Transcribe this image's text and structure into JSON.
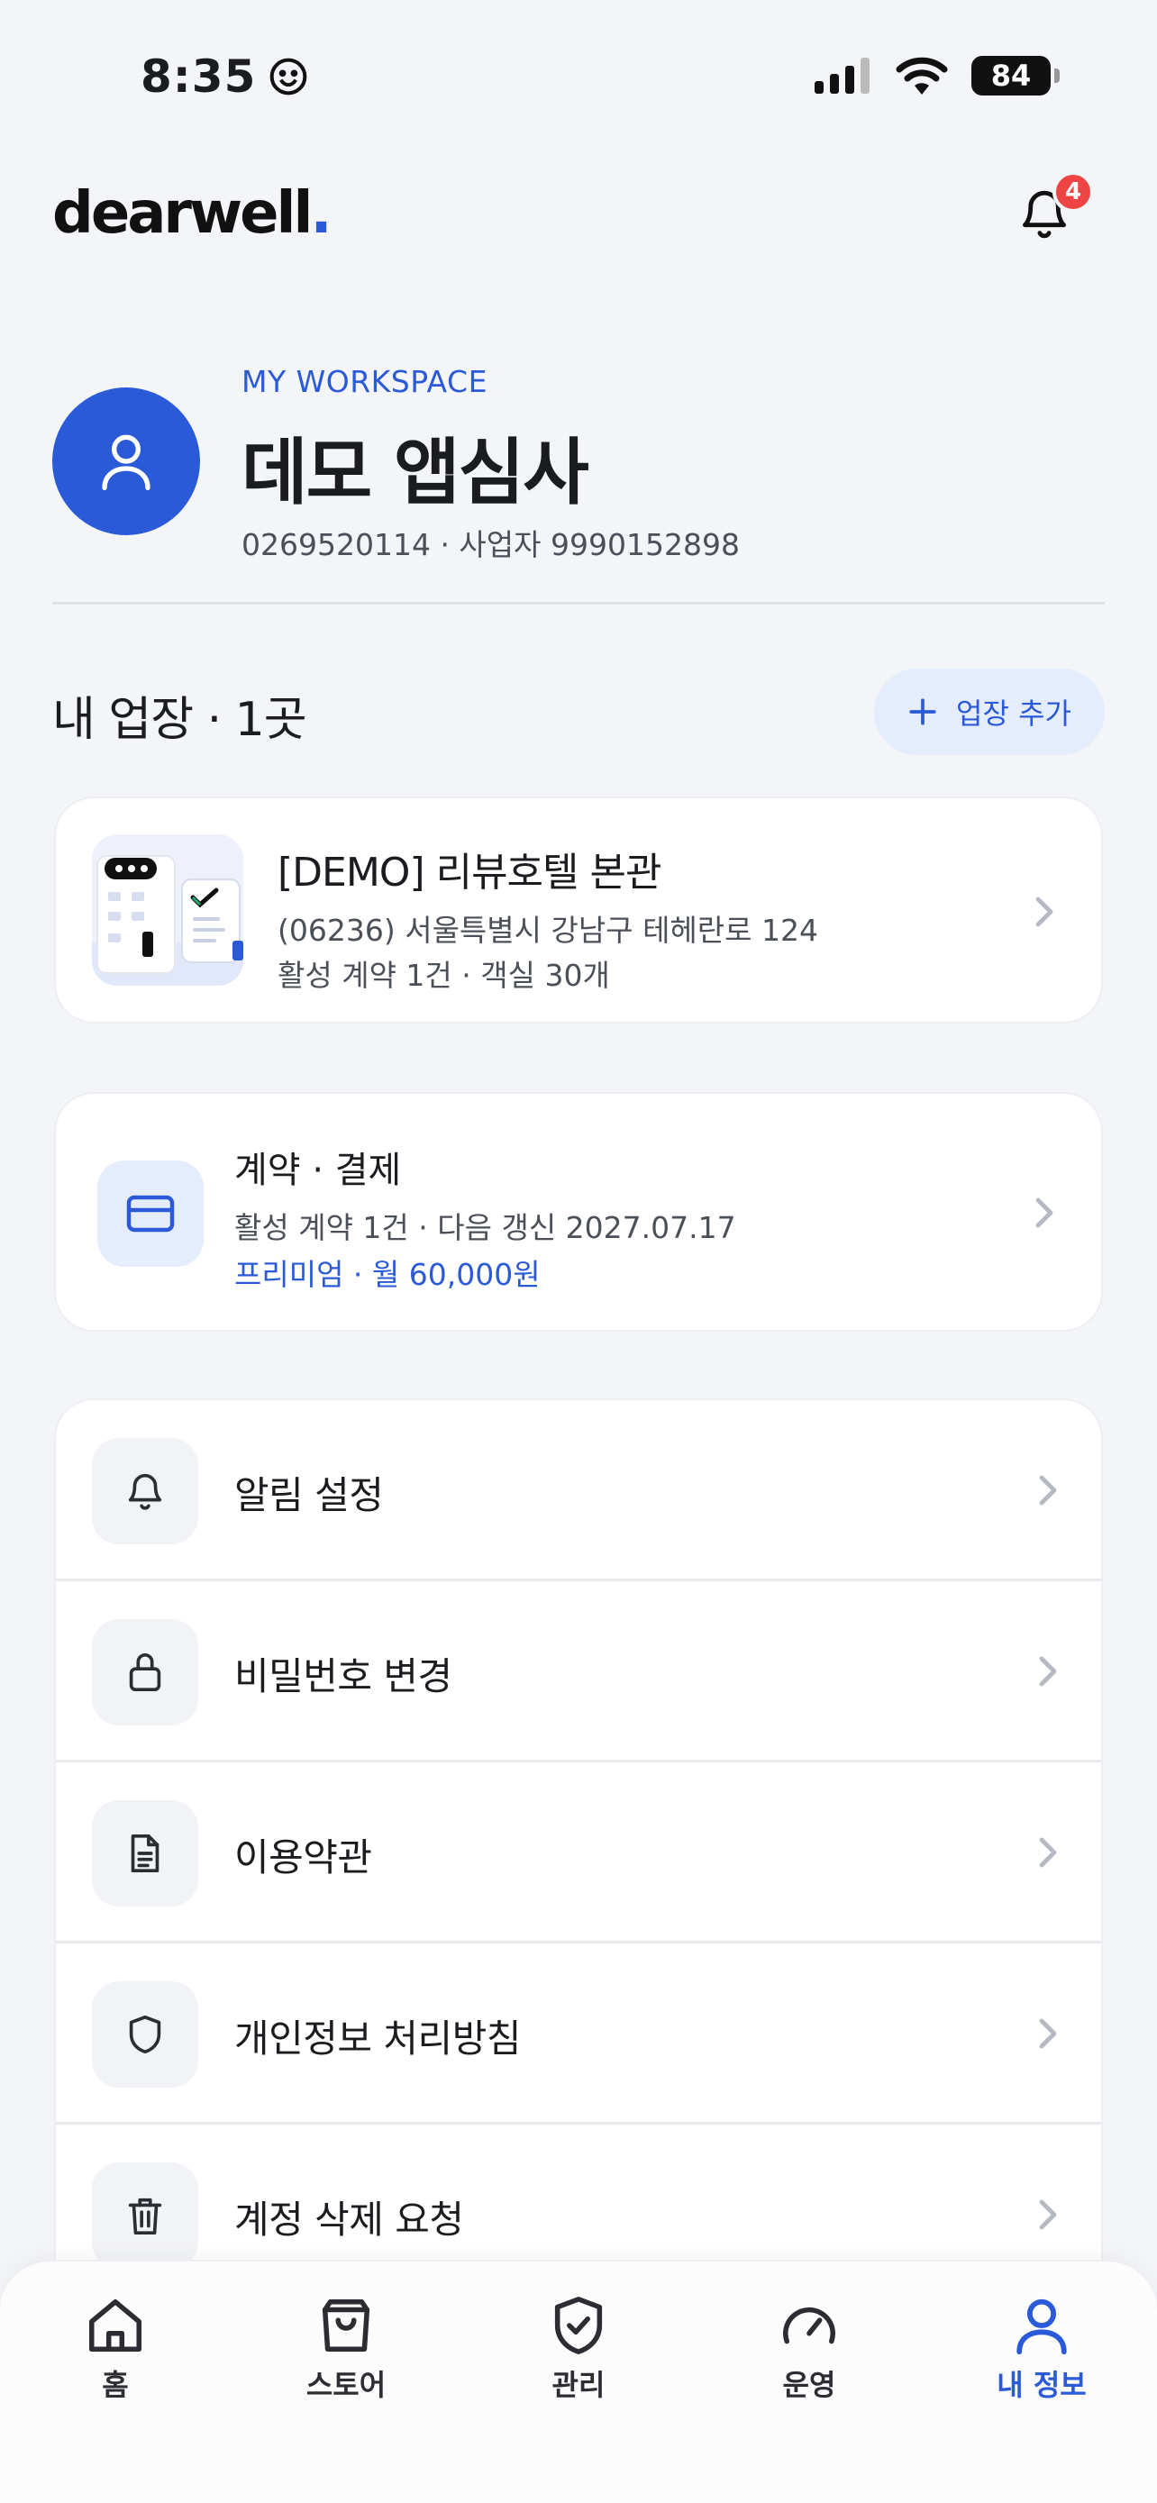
{
  "status_bar": {
    "time": "8:35",
    "battery": "84"
  },
  "header": {
    "logo_text": "dearwell",
    "logo_dot": ".",
    "notification_count": "4"
  },
  "workspace": {
    "label": "MY WORKSPACE",
    "name": "데모 앱심사",
    "details": "0269520114 · 사업자 9990152898"
  },
  "places": {
    "title": "내 업장 · 1곳",
    "add_button": "업장 추가",
    "items": [
      {
        "name": "[DEMO] 리뷰호텔 본관",
        "address": "(06236) 서울특별시 강남구 테헤란로 124",
        "meta": "활성 계약 1건 · 객실 30개"
      }
    ]
  },
  "billing": {
    "title": "계약 · 결제",
    "subtitle": "활성 계약 1건 · 다음 갱신 2027.07.17",
    "plan": "프리미엄 · 월 60,000원"
  },
  "menu": {
    "items": [
      {
        "label": "알림 설정",
        "icon": "bell-icon"
      },
      {
        "label": "비밀번호 변경",
        "icon": "lock-icon"
      },
      {
        "label": "이용약관",
        "icon": "document-icon"
      },
      {
        "label": "개인정보 처리방침",
        "icon": "shield-icon"
      },
      {
        "label": "계정 삭제 요청",
        "icon": "trash-icon"
      }
    ]
  },
  "tabbar": {
    "items": [
      {
        "label": "홈",
        "icon": "home-icon"
      },
      {
        "label": "스토어",
        "icon": "shopping-bag-icon"
      },
      {
        "label": "관리",
        "icon": "shield-check-icon"
      },
      {
        "label": "운영",
        "icon": "gauge-icon"
      },
      {
        "label": "내 정보",
        "icon": "user-icon"
      }
    ],
    "active_index": 4
  },
  "colors": {
    "accent": "#2a5ad8",
    "badge": "#ef4444",
    "background": "#f4f5f8"
  }
}
